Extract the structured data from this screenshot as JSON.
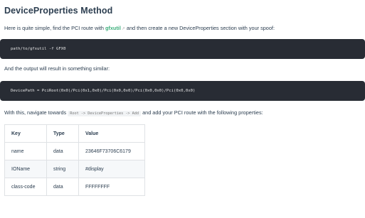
{
  "heading": "DeviceProperties Method",
  "intro": {
    "before": "Here is quite simple, find the PCI route with ",
    "link": "gfxutil",
    "after": " and then create a new DeviceProperties section with your spoof:"
  },
  "code1": "path/to/gfxutil -f GFX0",
  "output_text": "And the output will result in something similar:",
  "code2": "DevicePath = PciRoot(0x0)/Pci(0x1,0x0)/Pci(0x0,0x0)/Pci(0x0,0x0)/Pci(0x0,0x0)",
  "navigate": {
    "before": "With this, navigate towards ",
    "code": "Root -> DeviceProperties -> Add",
    "after": " and add your PCI route with the following properties:"
  },
  "table": {
    "headers": [
      "Key",
      "Type",
      "Value"
    ],
    "rows": [
      [
        "name",
        "data",
        "23646F73706C6179"
      ],
      [
        "IOName",
        "string",
        "#display"
      ],
      [
        "class-code",
        "data",
        "FFFFFFFF"
      ]
    ]
  }
}
